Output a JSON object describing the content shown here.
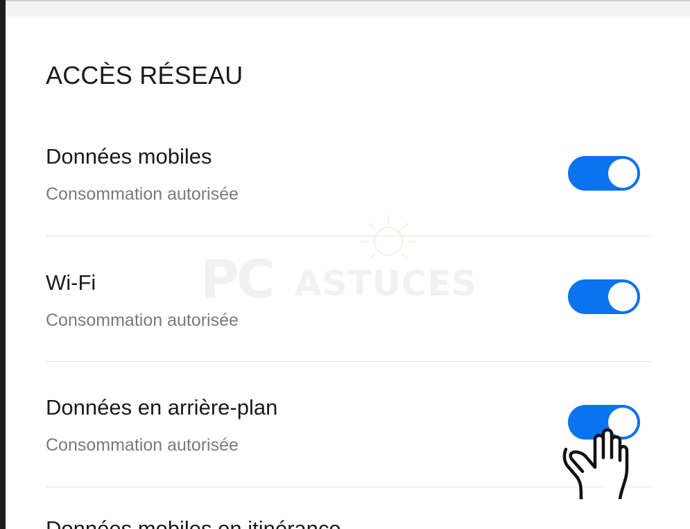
{
  "section": {
    "title": "ACCÈS RÉSEAU"
  },
  "settings": [
    {
      "title": "Données mobiles",
      "subtitle": "Consommation autorisée",
      "enabled": true
    },
    {
      "title": "Wi-Fi",
      "subtitle": "Consommation autorisée",
      "enabled": true
    },
    {
      "title": "Données en arrière-plan",
      "subtitle": "Consommation autorisée",
      "enabled": true
    },
    {
      "title": "Données mobiles en itinérance"
    }
  ],
  "watermark": {
    "brand_pc": "PC",
    "brand_rest": "ASTUCES"
  },
  "colors": {
    "accent": "#0a73f0",
    "subtitle": "#7a7a7a",
    "divider": "#e3e3e3"
  },
  "icons": {
    "pointer": "hand-pointer-icon",
    "watermark_logo": "sun-logo-icon"
  }
}
